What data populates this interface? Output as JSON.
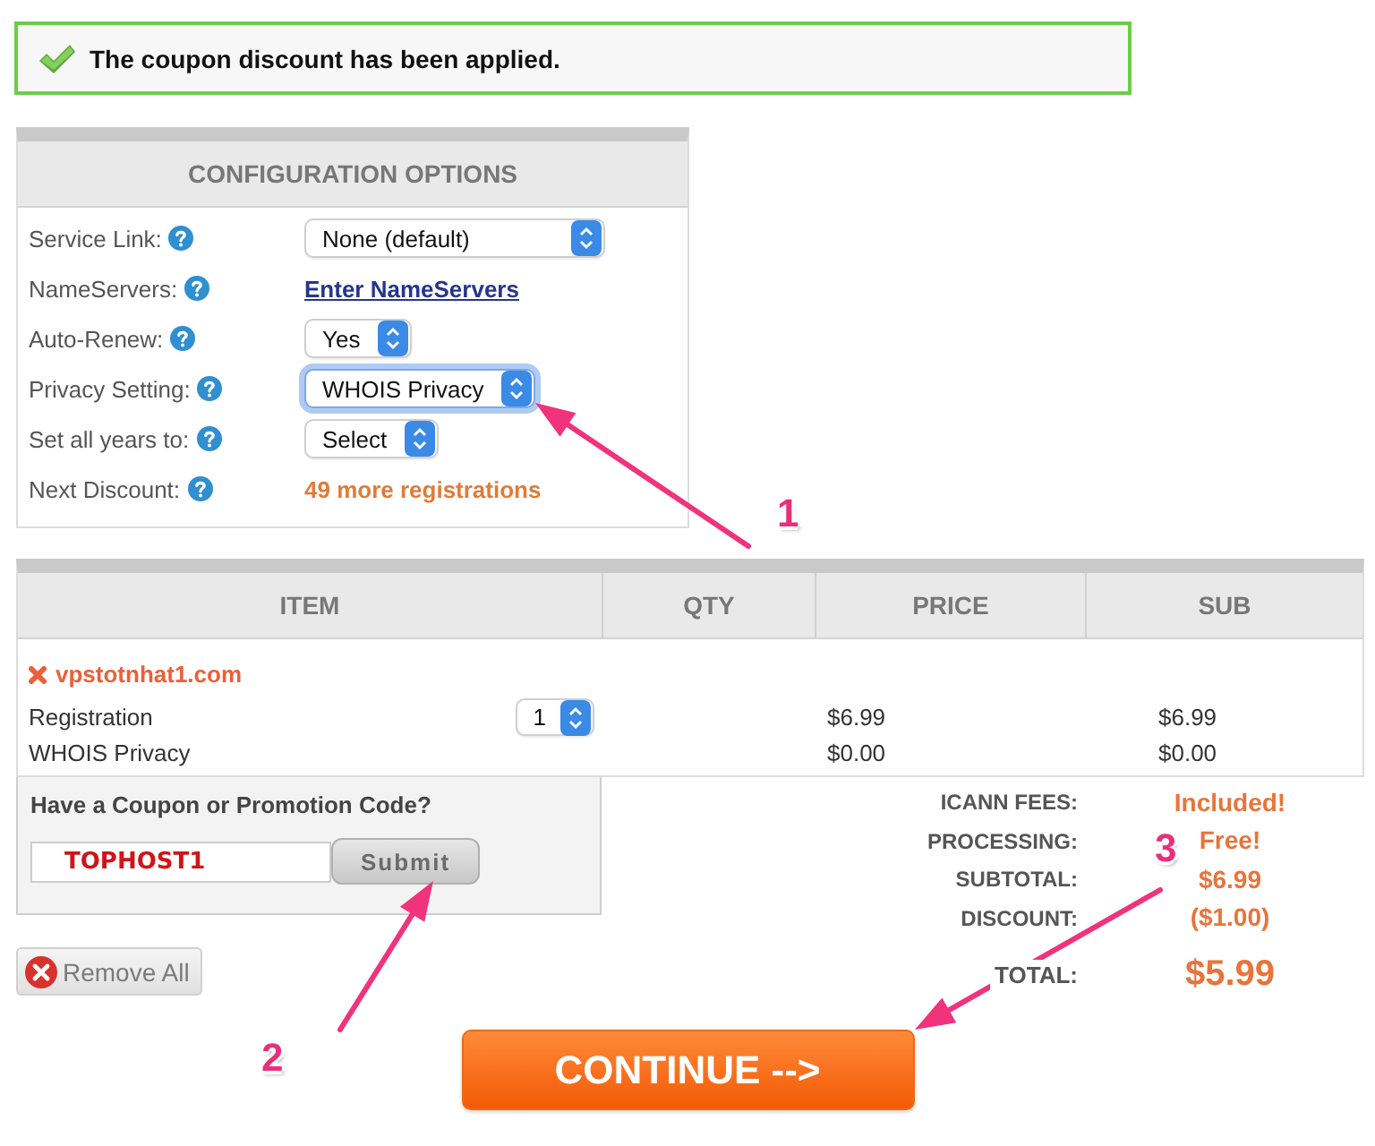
{
  "alert": {
    "text": "The coupon discount has been applied."
  },
  "config": {
    "title": "CONFIGURATION OPTIONS",
    "rows": [
      {
        "label": "Service Link:",
        "kind": "select",
        "value": "None (default)",
        "focused": false
      },
      {
        "label": "NameServers:",
        "kind": "link",
        "value": "Enter NameServers",
        "focused": false
      },
      {
        "label": "Auto-Renew:",
        "kind": "select",
        "value": "Yes",
        "focused": false
      },
      {
        "label": "Privacy Setting:",
        "kind": "select",
        "value": "WHOIS Privacy",
        "focused": true
      },
      {
        "label": "Set all years to:",
        "kind": "select",
        "value": "Select",
        "focused": false
      },
      {
        "label": "Next Discount:",
        "kind": "note",
        "value": "49 more registrations",
        "focused": false
      }
    ]
  },
  "cart": {
    "columns": [
      "ITEM",
      "QTY",
      "PRICE",
      "SUB"
    ],
    "domain": "vpstotnhat1.com",
    "lines": [
      {
        "name": "Registration",
        "qty": "1",
        "price": "$6.99",
        "sub": "$6.99"
      },
      {
        "name": "WHOIS Privacy",
        "price": "$0.00",
        "sub": "$0.00"
      }
    ]
  },
  "coupon": {
    "title": "Have a Coupon or Promotion Code?",
    "value": "TOPHOST1",
    "button": "Submit",
    "disabled": true
  },
  "totals": [
    {
      "label": "ICANN FEES:",
      "value": "Included!",
      "kind": "line"
    },
    {
      "label": "PROCESSING:",
      "value": "Free!",
      "kind": "line"
    },
    {
      "label": "SUBTOTAL:",
      "value": "$6.99",
      "kind": "line"
    },
    {
      "label": "DISCOUNT:",
      "value": "($1.00)",
      "kind": "line"
    },
    {
      "label": "TOTAL:",
      "value": "$5.99",
      "kind": "total"
    }
  ],
  "remove_all": "Remove All",
  "continue_button": "CONTINUE -->",
  "annotations": [
    {
      "number": "1"
    },
    {
      "number": "2"
    },
    {
      "number": "3"
    }
  ]
}
